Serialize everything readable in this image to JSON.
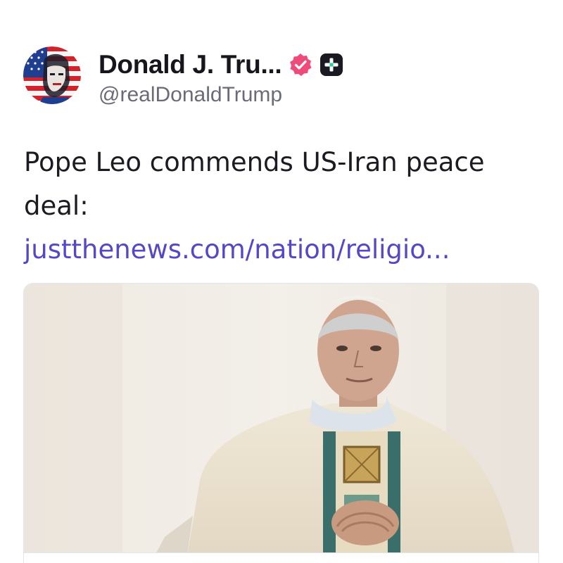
{
  "post": {
    "author": {
      "display_name": "Donald J. Tru...",
      "handle": "@realDonaldTrump",
      "avatar_icon": "flag-portrait-avatar",
      "verified_icon": "verified-badge-icon",
      "extra_badge_icon": "plus-badge-icon"
    },
    "text": "Pope Leo commends US-Iran peace deal: ",
    "link_text": "justthenews.com/nation/religio...",
    "media": {
      "type": "photo",
      "icon": "link-preview-image"
    }
  },
  "colors": {
    "name": "#16161d",
    "handle": "#6b6b78",
    "body": "#1b1b22",
    "link": "#5448c8",
    "verified": "#ee4b7b",
    "badge_dark": "#1a1a22"
  }
}
